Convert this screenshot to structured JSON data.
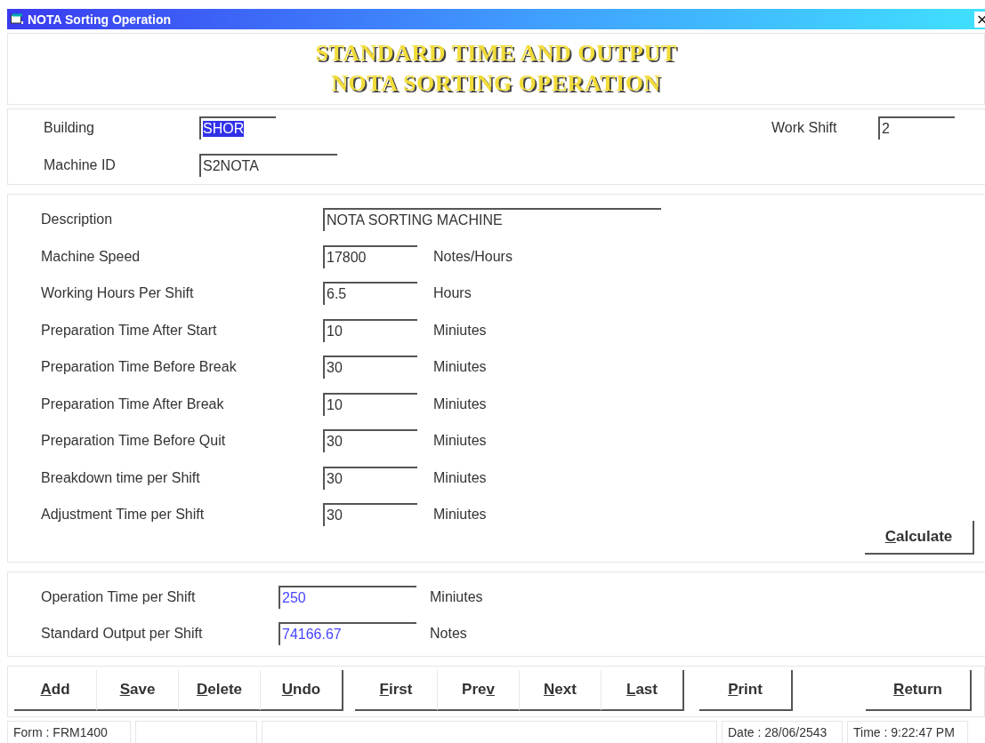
{
  "window": {
    "title": "NOTA Sorting Operation",
    "close": "×"
  },
  "header": {
    "lines": [
      "STANDARD TIME AND OUTPUT",
      "NOTA SORTING OPERATION"
    ]
  },
  "identity": {
    "building": {
      "label": "Building",
      "value": "SHOR",
      "text_selected": true
    },
    "machine_id": {
      "label": "Machine ID",
      "value": "S2NOTA",
      "text_selected": false
    },
    "work_shift": {
      "label": "Work Shift",
      "value": "2",
      "text_selected": false
    }
  },
  "parameters": [
    {
      "label": "Description",
      "value": "NOTA SORTING MACHINE",
      "kind": "wide"
    },
    {
      "label": "Machine Speed",
      "value": "17800",
      "unit": "Notes/Hours",
      "kind": "short"
    },
    {
      "label": "Working Hours Per Shift",
      "value": "6.5",
      "unit": "Hours",
      "kind": "short"
    },
    {
      "label": "Preparation Time After Start",
      "value": "10",
      "unit": "Miniutes",
      "kind": "short"
    },
    {
      "label": "Preparation Time Before Break",
      "value": "30",
      "unit": "Miniutes",
      "kind": "short"
    },
    {
      "label": "Preparation Time After Break",
      "value": "10",
      "unit": "Miniutes",
      "kind": "short"
    },
    {
      "label": "Preparation Time Before Quit",
      "value": "30",
      "unit": "Miniutes",
      "kind": "short"
    },
    {
      "label": "Breakdown time per Shift",
      "value": "30",
      "unit": "Miniutes",
      "kind": "short"
    },
    {
      "label": "Adjustment Time per Shift",
      "value": "30",
      "unit": "Miniutes",
      "kind": "short"
    }
  ],
  "calculate_button": {
    "key": "C",
    "after": "alculate"
  },
  "results": [
    {
      "label": "Operation Time per Shift",
      "value": "250",
      "unit": "Miniutes"
    },
    {
      "label": "Standard Output per Shift",
      "value": "74166.67",
      "unit": "Notes"
    }
  ],
  "toolbar": [
    [
      {
        "key": "A",
        "after": "dd"
      },
      {
        "key": "S",
        "after": "ave"
      },
      {
        "key": "D",
        "after": "elete"
      },
      {
        "key": "U",
        "after": "ndo"
      }
    ],
    [
      {
        "key": "F",
        "after": "irst"
      },
      {
        "before": "Pre",
        "key": "v"
      },
      {
        "key": "N",
        "after": "ext"
      },
      {
        "key": "L",
        "after": "ast"
      }
    ],
    [
      {
        "key": "P",
        "after": "rint"
      }
    ],
    [
      {
        "key": "R",
        "after": "eturn"
      }
    ]
  ],
  "status_bar": [
    {
      "text": "Form : FRM1400",
      "kind": "form"
    },
    {
      "kind": "blank"
    },
    {
      "kind": "wide"
    },
    {
      "text": "Date : 28/06/2543",
      "kind": "date"
    },
    {
      "text": "Time : 9:22:47 PM",
      "kind": "time"
    }
  ]
}
